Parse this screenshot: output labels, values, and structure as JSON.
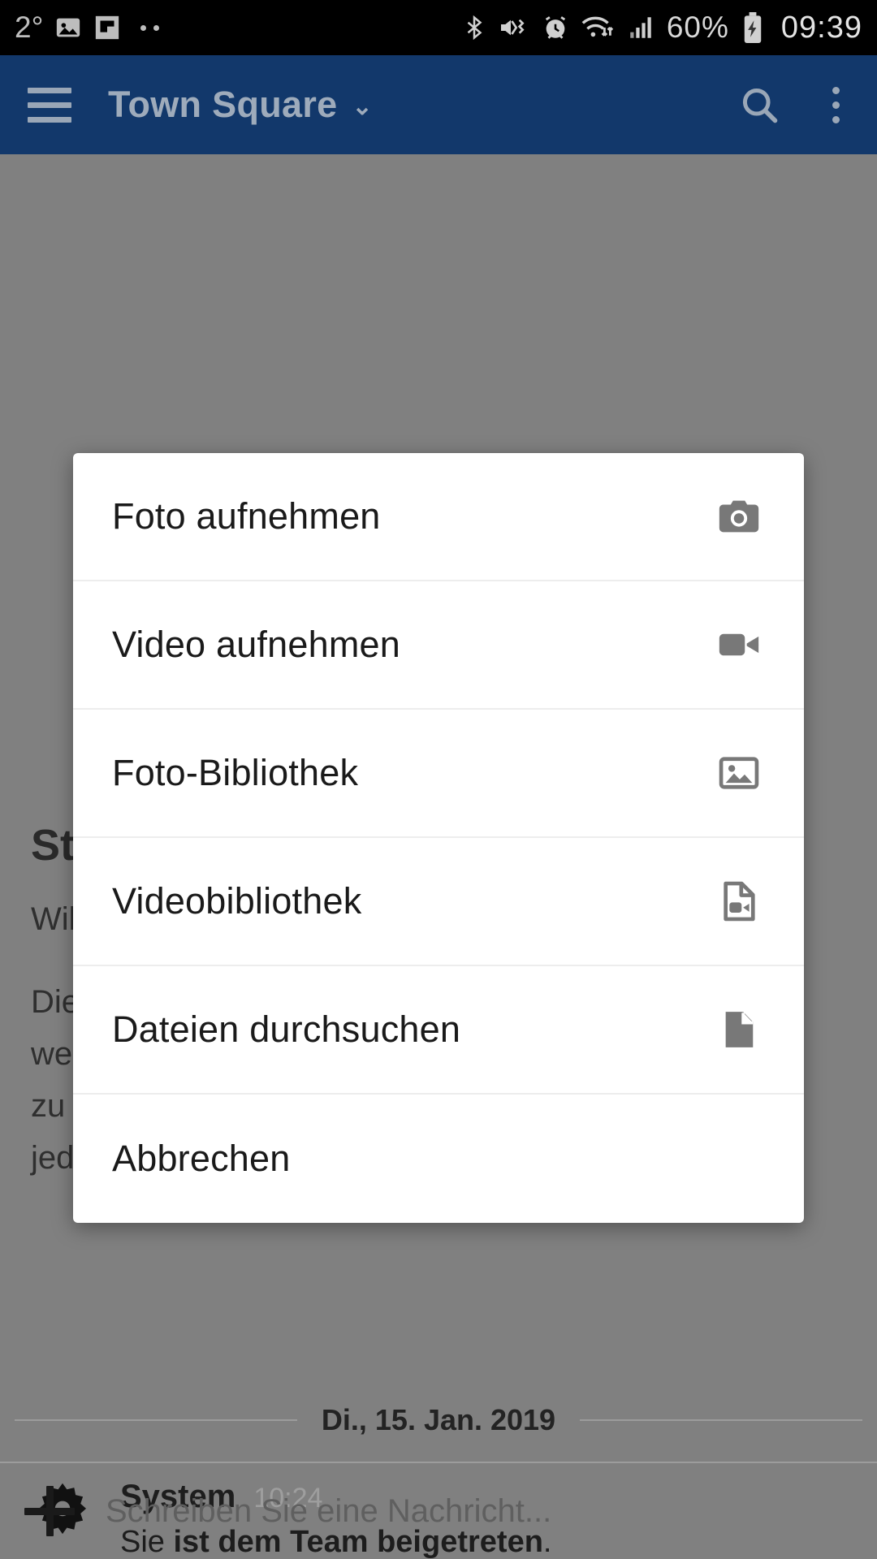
{
  "statusbar": {
    "temperature": "2°",
    "left_icons": [
      "photo-icon",
      "flipboard-icon",
      "two-dots-icon"
    ],
    "right_icons": [
      "bluetooth-icon",
      "mute-vibrate-icon",
      "alarm-icon",
      "wifi-icon",
      "signal-icon"
    ],
    "battery_percent": "60%",
    "battery_icon": "battery-charging-icon",
    "clock": "09:39",
    "background": "#000000",
    "foreground": "#c8c8c8"
  },
  "toolbar": {
    "menu_icon": "hamburger-icon",
    "title": "Town Square",
    "chevron": "⌄",
    "search_icon": "search-icon",
    "overflow_icon": "overflow-menu-icon",
    "background": "#12386b",
    "foreground": "#9eabbb"
  },
  "background_content": {
    "heading": "St",
    "paragraph_1": "Wil",
    "paragraph_2": "Die\nwe\nzu\njed",
    "date_divider": "Di., 15. Jan. 2019",
    "system_message": {
      "author": "System",
      "time": "10:24",
      "text_prefix": "Sie ",
      "text_bold": "ist dem Team beigetreten",
      "text_suffix": ".",
      "avatar_icon": "gear-icon"
    },
    "input": {
      "add_icon": "plus-icon",
      "placeholder": "Schreiben Sie eine Nachricht..."
    }
  },
  "dialog": {
    "items": [
      {
        "label": "Foto aufnehmen",
        "icon": "camera-icon"
      },
      {
        "label": "Video aufnehmen",
        "icon": "video-camera-icon"
      },
      {
        "label": "Foto-Bibliothek",
        "icon": "image-library-icon"
      },
      {
        "label": "Videobibliothek",
        "icon": "video-file-icon"
      },
      {
        "label": "Dateien durchsuchen",
        "icon": "document-icon"
      },
      {
        "label": "Abbrechen",
        "icon": "none"
      }
    ],
    "background": "#ffffff",
    "icon_color": "#787878"
  }
}
